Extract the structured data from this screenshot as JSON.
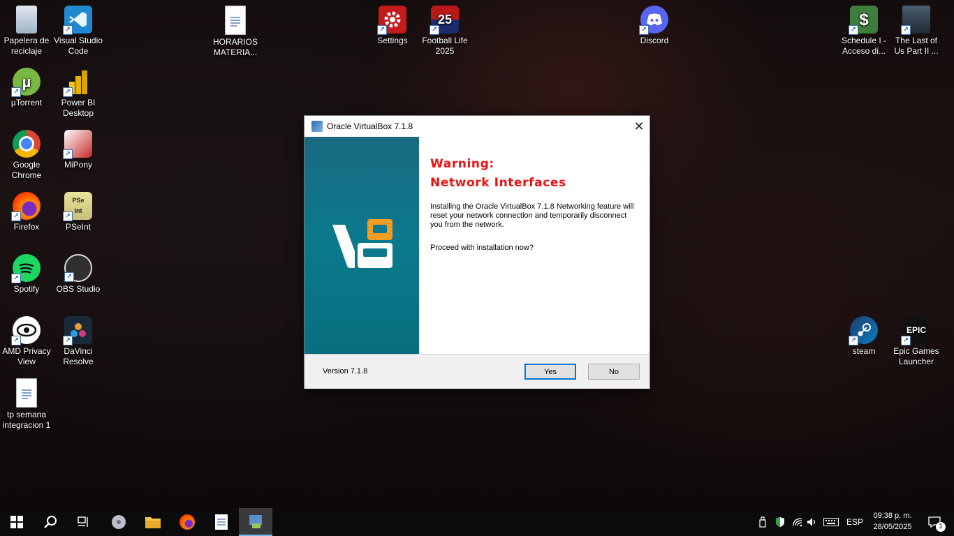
{
  "desktop": {
    "icons": [
      {
        "label": "Papelera de reciclaje",
        "icon": "recycle-bin-icon"
      },
      {
        "label": "Visual Studio Code",
        "icon": "vscode-icon"
      },
      {
        "label": "HORARIOS MATERIA...",
        "icon": "document-icon"
      },
      {
        "label": "Settings",
        "icon": "settings-gear-icon"
      },
      {
        "label": "Football Life 2025",
        "icon": "football-life-icon"
      },
      {
        "label": "Discord",
        "icon": "discord-icon"
      },
      {
        "label": "Schedule I - Acceso di...",
        "icon": "schedule-i-icon"
      },
      {
        "label": "The Last of Us Part II ...",
        "icon": "last-of-us-icon"
      },
      {
        "label": "µTorrent",
        "icon": "utorrent-icon"
      },
      {
        "label": "Power BI Desktop",
        "icon": "powerbi-icon"
      },
      {
        "label": "Google Chrome",
        "icon": "chrome-icon"
      },
      {
        "label": "MiPony",
        "icon": "mipony-icon"
      },
      {
        "label": "Firefox",
        "icon": "firefox-icon"
      },
      {
        "label": "PSeInt",
        "icon": "pseint-icon"
      },
      {
        "label": "Spotify",
        "icon": "spotify-icon"
      },
      {
        "label": "OBS Studio",
        "icon": "obs-icon"
      },
      {
        "label": "AMD Privacy View",
        "icon": "amd-privacy-icon"
      },
      {
        "label": "DaVinci Resolve",
        "icon": "davinci-icon"
      },
      {
        "label": "steam",
        "icon": "steam-icon"
      },
      {
        "label": "Epic Games Launcher",
        "icon": "epic-games-icon"
      },
      {
        "label": "tp semana integracion 1",
        "icon": "document-icon"
      }
    ]
  },
  "dialog": {
    "title": "Oracle VirtualBox 7.1.8",
    "close": "✕",
    "warning_line1": "Warning:",
    "warning_line2": "Network Interfaces",
    "body": "Installing the Oracle VirtualBox 7.1.8 Networking feature will reset your network connection and temporarily disconnect you from the network.",
    "question": "Proceed with installation now?",
    "version": "Version 7.1.8",
    "yes_label": "Yes",
    "no_label": "No",
    "banner_color": "#0a7a8c",
    "warning_color": "#e11111"
  },
  "taskbar": {
    "language": "ESP",
    "time": "09:38 p. m.",
    "date": "28/05/2025",
    "notification_count": "1"
  }
}
